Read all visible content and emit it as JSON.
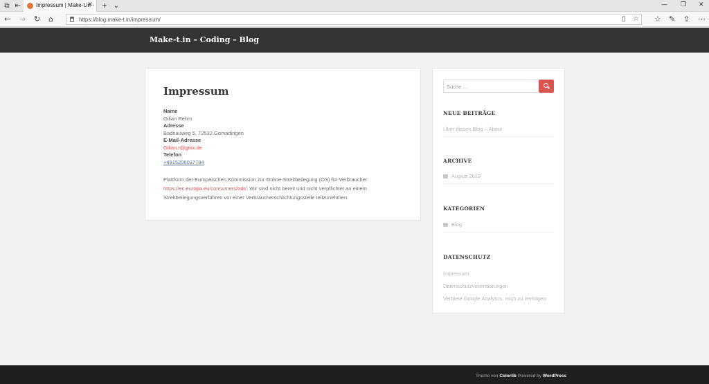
{
  "browser": {
    "tab_title": "Impressum | Make-t.in -",
    "url": "https://blog.make-t.in/impressum/"
  },
  "site": {
    "title": "Make-t.in – Coding – Blog"
  },
  "page": {
    "title": "Impressum",
    "name_label": "Name",
    "name_value": "Gilian Rehm",
    "address_label": "Adresse",
    "address_value": "Badnauweg 5, 72532 Gomadingen",
    "email_label": "E-Mail-Adresse",
    "email_value": "Gilian.r@gmx.de",
    "phone_label": "Telefon",
    "phone_value": "+4915206037794",
    "para_1": "Plattform der Europäischen Kommission zur Online-Streitbeilegung (OS) für Verbraucher:",
    "para_link": "https://ec.europa.eu/consumers/odr/",
    "para_2": ". Wir sind nicht bereit und nicht verpflichtet an einem Streitbeilegungsverfahren vor einer Verbraucherschlichtungsstelle teilzunehmen."
  },
  "sidebar": {
    "search_placeholder": "Suche …",
    "recent_title": "NEUE BEITRÄGE",
    "recent_item": "Über diesen Blog – About",
    "archive_title": "ARCHIVE",
    "archive_item": "August 2019",
    "categories_title": "KATEGORIEN",
    "categories_item": "Blog",
    "privacy_title": "DATENSCHUTZ",
    "privacy_items": [
      "Impressum",
      "Datenschutzvereinbarungen",
      "Verbiete Google Analytics, mich zu verfolgen"
    ]
  },
  "footer": {
    "theme_by": "Theme von",
    "colorlib": "Colorlib",
    "powered_by": "Powered by",
    "wordpress": "WordPress"
  },
  "colors": {
    "header": "#333333",
    "accent": "#d9534f",
    "footer": "#1f1f1f"
  }
}
